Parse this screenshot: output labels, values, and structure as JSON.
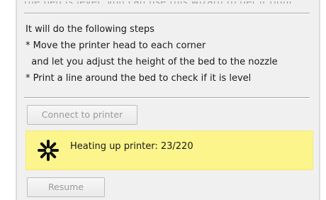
{
  "wizard": {
    "cut_off_text": "the bed is level, you can use this wizard to get it right",
    "steps": [
      "It will do the following steps",
      "* Move the printer head to each corner",
      "  and let you adjust the height of the bed to the nozzle",
      "* Print a line around the bed to check if it is level"
    ],
    "connect_label": "Connect to printer",
    "status_text": "Heating up printer: 23/220",
    "spinner_icon": "busy-spinner-icon",
    "resume_label": "Resume"
  },
  "colors": {
    "panel_bg": "#f0f0f0",
    "status_bg": "#fbf58c",
    "disabled_text": "#9a9a9a",
    "spinner": "#111111"
  }
}
